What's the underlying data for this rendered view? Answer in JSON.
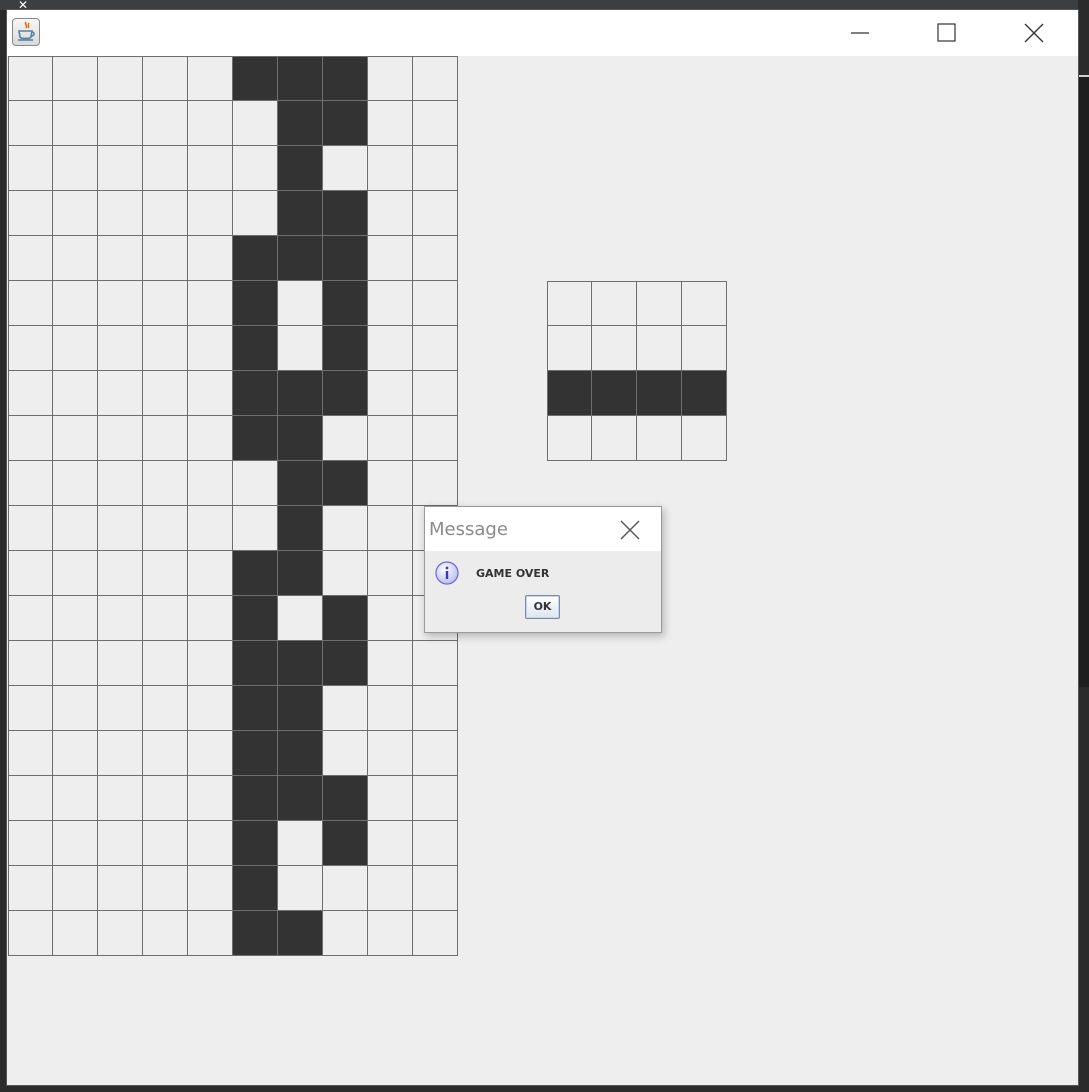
{
  "window": {
    "app_icon": "java-cup-icon"
  },
  "board": {
    "cols": 10,
    "rows": 20,
    "filled_rows": [
      [
        0,
        0,
        0,
        0,
        0,
        1,
        1,
        1,
        0,
        0
      ],
      [
        0,
        0,
        0,
        0,
        0,
        0,
        1,
        1,
        0,
        0
      ],
      [
        0,
        0,
        0,
        0,
        0,
        0,
        1,
        0,
        0,
        0
      ],
      [
        0,
        0,
        0,
        0,
        0,
        0,
        1,
        1,
        0,
        0
      ],
      [
        0,
        0,
        0,
        0,
        0,
        1,
        1,
        1,
        0,
        0
      ],
      [
        0,
        0,
        0,
        0,
        0,
        1,
        0,
        1,
        0,
        0
      ],
      [
        0,
        0,
        0,
        0,
        0,
        1,
        0,
        1,
        0,
        0
      ],
      [
        0,
        0,
        0,
        0,
        0,
        1,
        1,
        1,
        0,
        0
      ],
      [
        0,
        0,
        0,
        0,
        0,
        1,
        1,
        0,
        0,
        0
      ],
      [
        0,
        0,
        0,
        0,
        0,
        0,
        1,
        1,
        0,
        0
      ],
      [
        0,
        0,
        0,
        0,
        0,
        0,
        1,
        0,
        0,
        0
      ],
      [
        0,
        0,
        0,
        0,
        0,
        1,
        1,
        0,
        0,
        0
      ],
      [
        0,
        0,
        0,
        0,
        0,
        1,
        0,
        1,
        0,
        0
      ],
      [
        0,
        0,
        0,
        0,
        0,
        1,
        1,
        1,
        0,
        0
      ],
      [
        0,
        0,
        0,
        0,
        0,
        1,
        1,
        0,
        0,
        0
      ],
      [
        0,
        0,
        0,
        0,
        0,
        1,
        1,
        0,
        0,
        0
      ],
      [
        0,
        0,
        0,
        0,
        0,
        1,
        1,
        1,
        0,
        0
      ],
      [
        0,
        0,
        0,
        0,
        0,
        1,
        0,
        1,
        0,
        0
      ],
      [
        0,
        0,
        0,
        0,
        0,
        1,
        0,
        0,
        0,
        0
      ],
      [
        0,
        0,
        0,
        0,
        0,
        1,
        1,
        0,
        0,
        0
      ]
    ]
  },
  "next_piece": {
    "cols": 4,
    "rows": 4,
    "filled_rows": [
      [
        0,
        0,
        0,
        0
      ],
      [
        0,
        0,
        0,
        0
      ],
      [
        1,
        1,
        1,
        1
      ],
      [
        0,
        0,
        0,
        0
      ]
    ]
  },
  "dialog": {
    "title": "Message",
    "icon": "info-icon",
    "message": "GAME OVER",
    "ok_label": "OK"
  },
  "colors": {
    "filled": "#333333",
    "empty": "#eeeeee",
    "grid_line": "#6e6e6e"
  }
}
